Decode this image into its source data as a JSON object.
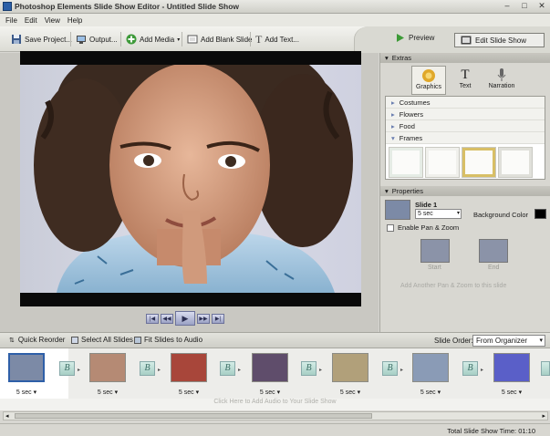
{
  "window": {
    "title": "Photoshop Elements Slide Show Editor - Untitled Slide Show"
  },
  "menu": [
    "File",
    "Edit",
    "View",
    "Help"
  ],
  "toolbar": {
    "save": "Save Project...",
    "output": "Output...",
    "add_media": "Add Media",
    "add_blank": "Add Blank Slide",
    "add_text": "Add Text..."
  },
  "modes": {
    "preview": "Preview",
    "edit": "Edit Slide Show"
  },
  "extras": {
    "header": "Extras",
    "tabs": [
      "Graphics",
      "Text",
      "Narration"
    ],
    "categories": [
      "Costumes",
      "Flowers",
      "Food",
      "Frames"
    ]
  },
  "properties": {
    "header": "Properties",
    "slide_label": "Slide 1",
    "duration": "5 sec",
    "bg_label": "Background Color",
    "bg_color": "#000000",
    "pan_zoom_label": "Enable Pan & Zoom",
    "start": "Start",
    "end": "End",
    "add_pz": "Add Another Pan & Zoom to this slide"
  },
  "bottombar": {
    "quick_reorder": "Quick Reorder",
    "select_all": "Select All Slides",
    "fit_audio": "Fit Slides to Audio",
    "slide_order_label": "Slide Order:",
    "slide_order_value": "From Organizer"
  },
  "slides": [
    {
      "duration": "5 sec",
      "color": "#7c8aa6"
    },
    {
      "duration": "5 sec",
      "color": "#b58a74"
    },
    {
      "duration": "5 sec",
      "color": "#a8463a"
    },
    {
      "duration": "5 sec",
      "color": "#5f4d6b"
    },
    {
      "duration": "5 sec",
      "color": "#b1a07a"
    },
    {
      "duration": "5 sec",
      "color": "#8a9bb6"
    },
    {
      "duration": "5 sec",
      "color": "#5a5fc8"
    }
  ],
  "transition_glyph": "B",
  "audio_hint": "Click Here to Add Audio to Your Slide Show",
  "status": {
    "total_time": "Total Slide Show Time: 01:10"
  }
}
